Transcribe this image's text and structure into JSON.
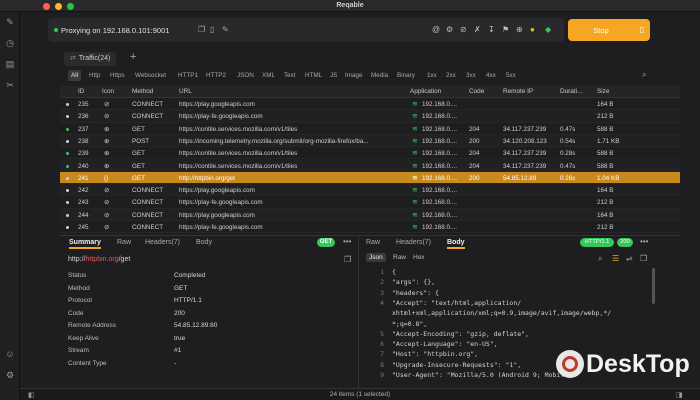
{
  "window": {
    "title": "Reqable"
  },
  "proxy": {
    "status_text": "Proxying on 192.168.0.101:9001",
    "stop_label": "Stop"
  },
  "tabs": {
    "traffic_label": "Traffic(24)",
    "add_label": "+"
  },
  "filters": [
    "All",
    "Http",
    "Https",
    "Websocket",
    "HTTP1",
    "HTTP2",
    "JSON",
    "XML",
    "Text",
    "HTML",
    "JS",
    "Image",
    "Media",
    "Binary",
    "1xx",
    "2xx",
    "3xx",
    "4xx",
    "5xx"
  ],
  "table": {
    "columns": [
      "ID",
      "Icon",
      "Method",
      "URL",
      "Application",
      "Code",
      "Remote IP",
      "Durati...",
      "Size"
    ],
    "rows": [
      {
        "dot": "white",
        "id": "235",
        "method": "CONNECT",
        "url": "https://play.googleapis.com",
        "app": "192.168.0....",
        "code": "",
        "ip": "",
        "dur": "",
        "size": "164 B"
      },
      {
        "dot": "white",
        "id": "236",
        "method": "CONNECT",
        "url": "https://play-fe.googleapis.com",
        "app": "192.168.0....",
        "code": "",
        "ip": "",
        "dur": "",
        "size": "212 B"
      },
      {
        "dot": "green",
        "id": "237",
        "method": "GET",
        "url": "https://contile.services.mozilla.com/v1/tiles",
        "app": "192.168.0....",
        "code": "204",
        "ip": "34.117.237.239",
        "dur": "0.47s",
        "size": "588 B"
      },
      {
        "dot": "white",
        "id": "238",
        "method": "POST",
        "url": "https://incoming.telemetry.mozilla.org/submit/org-mozilla-firefox/ba...",
        "app": "192.168.0....",
        "code": "200",
        "ip": "34.120.208.123",
        "dur": "0.54s",
        "size": "1.71 KB"
      },
      {
        "dot": "green",
        "id": "239",
        "method": "GET",
        "url": "https://contile.services.mozilla.com/v1/tiles",
        "app": "192.168.0....",
        "code": "204",
        "ip": "34.117.237.239",
        "dur": "0.28s",
        "size": "588 B"
      },
      {
        "dot": "green",
        "id": "240",
        "method": "GET",
        "url": "https://contile.services.mozilla.com/v1/tiles",
        "app": "192.168.0....",
        "code": "204",
        "ip": "34.117.237.239",
        "dur": "0.47s",
        "size": "588 B"
      },
      {
        "dot": "white",
        "id": "241",
        "method": "GET",
        "url": "http://httpbin.org/get",
        "app": "192.168.0....",
        "code": "200",
        "ip": "54.85.12.89",
        "dur": "0.26s",
        "size": "1.04 KB",
        "selected": true
      },
      {
        "dot": "white",
        "id": "242",
        "method": "CONNECT",
        "url": "https://play.googleapis.com",
        "app": "192.168.0....",
        "code": "",
        "ip": "",
        "dur": "",
        "size": "164 B"
      },
      {
        "dot": "white",
        "id": "243",
        "method": "CONNECT",
        "url": "https://play-fe.googleapis.com",
        "app": "192.168.0....",
        "code": "",
        "ip": "",
        "dur": "",
        "size": "212 B"
      },
      {
        "dot": "white",
        "id": "244",
        "method": "CONNECT",
        "url": "https://play.googleapis.com",
        "app": "192.168.0....",
        "code": "",
        "ip": "",
        "dur": "",
        "size": "164 B"
      },
      {
        "dot": "white",
        "id": "245",
        "method": "CONNECT",
        "url": "https://play-fe.googleapis.com",
        "app": "192.168.0....",
        "code": "",
        "ip": "",
        "dur": "",
        "size": "212 B"
      }
    ]
  },
  "details": {
    "tabs": [
      "Summary",
      "Raw",
      "Headers(7)",
      "Body"
    ],
    "method_badge": "GET",
    "url_prefix": "http://",
    "url_host": "httpbin.org",
    "url_path": "/get",
    "summary": [
      {
        "k": "Status",
        "v": "Completed"
      },
      {
        "k": "Method",
        "v": "GET"
      },
      {
        "k": "Protocol",
        "v": "HTTP/1.1"
      },
      {
        "k": "Code",
        "v": "200"
      },
      {
        "k": "Remote Address",
        "v": "54.85.12.89:80"
      },
      {
        "k": "Keep Alive",
        "v": "true"
      },
      {
        "k": "Stream",
        "v": "#1"
      },
      {
        "k": "Content Type",
        "v": "-"
      }
    ]
  },
  "response": {
    "tabs": [
      "Raw",
      "Headers(7)",
      "Body"
    ],
    "protocol_badge": "HTTP/1.1",
    "code_badge": "200",
    "subtabs": [
      "Json",
      "Raw",
      "Hex"
    ],
    "lines": [
      {
        "n": "1",
        "t": "{"
      },
      {
        "n": "2",
        "t": "  \"args\": {},"
      },
      {
        "n": "3",
        "t": "  \"headers\": {"
      },
      {
        "n": "4",
        "t": "    \"Accept\": \"text/html,application/"
      },
      {
        "n": "",
        "t": "xhtml+xml,application/xml;q=0.9,image/avif,image/webp,*/"
      },
      {
        "n": "",
        "t": "*;q=0.8\","
      },
      {
        "n": "5",
        "t": "    \"Accept-Encoding\": \"gzip, deflate\","
      },
      {
        "n": "6",
        "t": "    \"Accept-Language\": \"en-US\","
      },
      {
        "n": "7",
        "t": "    \"Host\": \"httpbin.org\","
      },
      {
        "n": "8",
        "t": "    \"Upgrade-Insecure-Requests\": \"1\","
      },
      {
        "n": "9",
        "t": "    \"User-Agent\": \"Mozilla/5.0 (Android 9; Mobile;"
      }
    ]
  },
  "status": {
    "text": "24 items (1 selected)"
  },
  "watermark": {
    "text": "DeskTop"
  },
  "colors": {
    "accent": "#f5a623",
    "selected_row": "#c88a1c",
    "success": "#34c759",
    "host_red": "#e05a5a"
  }
}
